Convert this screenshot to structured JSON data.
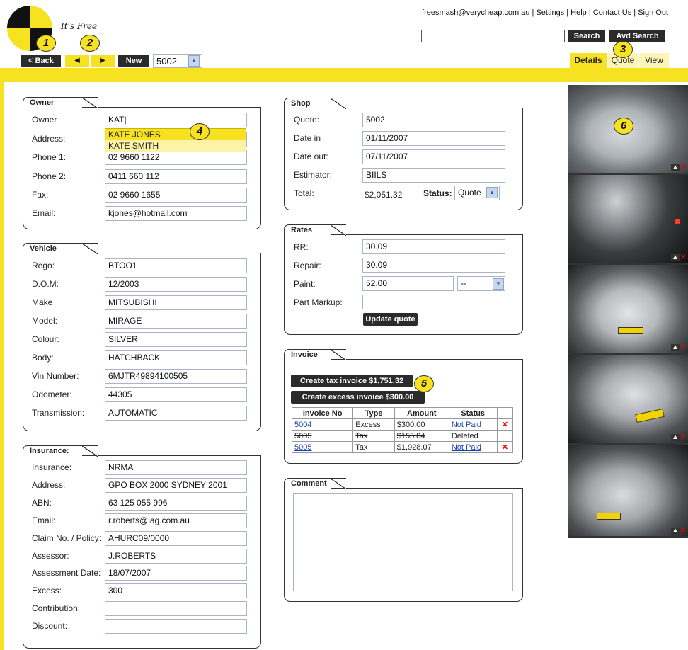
{
  "header": {
    "tagline": "It's Free",
    "email": "freesmash@verycheap.com.au",
    "links": [
      "Settings",
      "Help",
      "Contact Us",
      "Sign Out"
    ],
    "search_value": "",
    "search_btn": "Search",
    "avd_search_btn": "Avd Search",
    "back_btn": "< Back",
    "prev_icon": "triangle-left-icon",
    "next_icon": "triangle-right-icon",
    "new_btn": "New",
    "record_no": "5002",
    "tabs": [
      "Details",
      "Quote",
      "View"
    ],
    "active_tab": "Details"
  },
  "badges": [
    "1",
    "2",
    "3",
    "4",
    "5",
    "6"
  ],
  "owner": {
    "title": "Owner",
    "labels": {
      "owner": "Owner",
      "address": "Address:",
      "phone1": "Phone 1:",
      "phone2": "Phone 2:",
      "fax": "Fax:",
      "email": "Email:"
    },
    "owner": "KAT|",
    "suggestions": [
      "KATE JONES",
      "KATE SMITH"
    ],
    "address": "",
    "phone1": "02 9660 1122",
    "phone2": "0411 660 112",
    "fax": "02 9660 1655",
    "email": "kjones@hotmail.com"
  },
  "vehicle": {
    "title": "Vehicle",
    "fields": [
      {
        "label": "Rego:",
        "value": "BTOO1"
      },
      {
        "label": "D.O.M:",
        "value": "12/2003"
      },
      {
        "label": "Make",
        "value": "MITSUBISHI"
      },
      {
        "label": "Model:",
        "value": "MIRAGE"
      },
      {
        "label": "Colour:",
        "value": "SILVER"
      },
      {
        "label": "Body:",
        "value": "HATCHBACK"
      },
      {
        "label": "Vin Number:",
        "value": "6MJTR49894100505"
      },
      {
        "label": "Odometer:",
        "value": "44305"
      },
      {
        "label": "Transmission:",
        "value": "AUTOMATIC"
      }
    ]
  },
  "insurance": {
    "title": "Insurance:",
    "fields": [
      {
        "label": "Insurance:",
        "value": "NRMA"
      },
      {
        "label": "Address:",
        "value": "GPO BOX 2000 SYDNEY 2001"
      },
      {
        "label": "ABN:",
        "value": "63 125 055 996"
      },
      {
        "label": "Email:",
        "value": "r.roberts@iag.com.au"
      },
      {
        "label": "Claim No. / Policy:",
        "value": "AHURC09/0000"
      },
      {
        "label": "Assessor:",
        "value": "J.ROBERTS"
      },
      {
        "label": "Assessment Date:",
        "value": "18/07/2007"
      },
      {
        "label": "Excess:",
        "value": "300"
      },
      {
        "label": "Contribution:",
        "value": ""
      },
      {
        "label": "Discount:",
        "value": ""
      }
    ]
  },
  "shop": {
    "title": "Shop",
    "fields": [
      {
        "label": "Quote:",
        "value": "5002"
      },
      {
        "label": "Date in",
        "value": "01/11/2007"
      },
      {
        "label": "Date out:",
        "value": "07/11/2007"
      },
      {
        "label": "Estimator:",
        "value": "BIILS"
      }
    ],
    "total_label": "Total:",
    "total": "$2,051.32",
    "status_label": "Status:",
    "status": "Quote"
  },
  "rates": {
    "title": "Rates",
    "rr_label": "RR:",
    "rr": "30.09",
    "repair_label": "Repair:",
    "repair": "30.09",
    "paint_label": "Paint:",
    "paint": "52.00",
    "paint_select": "--",
    "markup_label": "Part Markup:",
    "markup": "",
    "update_btn": "Update quote"
  },
  "invoice": {
    "title": "Invoice",
    "tax_btn": "Create tax invoice $1,751.32",
    "excess_btn": "Create excess invoice $300.00",
    "columns": [
      "Invoice No",
      "Type",
      "Amount",
      "Status"
    ],
    "rows": [
      {
        "no": "5004",
        "type": "Excess",
        "amount": "$300.00",
        "status": "Not Paid",
        "deleted": false
      },
      {
        "no": "5005",
        "type": "Tax",
        "amount": "$155.84",
        "status": "Deleted",
        "deleted": true
      },
      {
        "no": "5005",
        "type": "Tax",
        "amount": "$1,928.07",
        "status": "Not Paid",
        "deleted": false
      }
    ]
  },
  "comment": {
    "title": "Comment",
    "value": ""
  },
  "photos": [
    "photo-car-front",
    "photo-dashboard",
    "photo-car-rear",
    "photo-rear-damage",
    "photo-car-rear-side"
  ]
}
